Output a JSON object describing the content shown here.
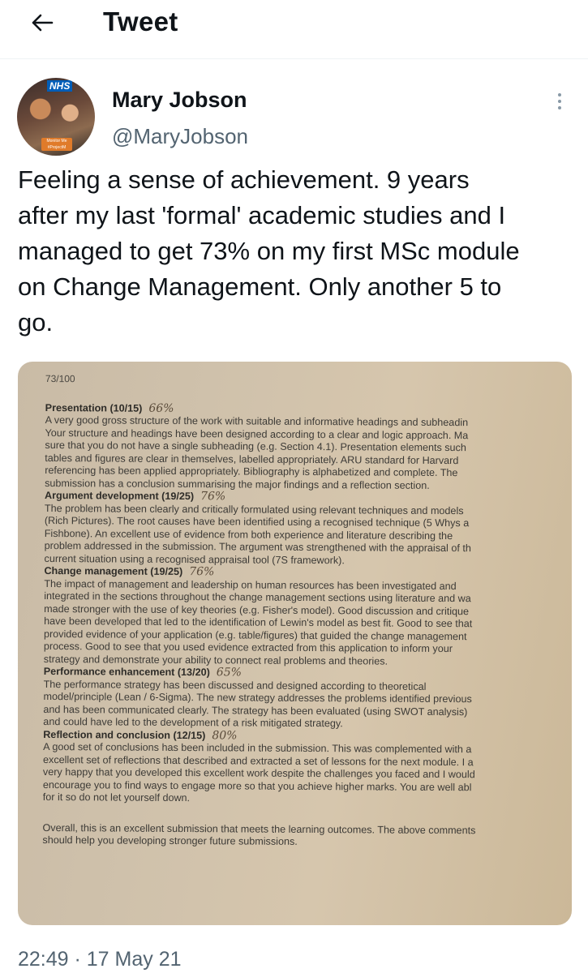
{
  "header": {
    "title": "Tweet",
    "back_icon": "arrow-left-icon"
  },
  "author": {
    "name": "Mary Jobson",
    "handle": "@MaryJobson",
    "avatar_badge": "NHS",
    "avatar_band": "Monitor Me #ProjectM"
  },
  "tweet": {
    "text": "Feeling a sense of achievement.  9 years\nafter my last 'formal' academic studies and I\nmanaged to get 73% on my first MSc module\non Change Management.  Only another 5 to\ngo."
  },
  "image": {
    "score": "73/100",
    "sections": [
      {
        "heading": "Presentation (10/15)",
        "handwritten": "66%",
        "lines": [
          "A very good gross structure of the work with suitable and informative headings and subheadin",
          "Your structure and headings have been designed according to a clear and logic approach. Ma",
          "sure that you do not have a single subheading (e.g. Section 4.1). Presentation elements such",
          "tables and figures are clear in themselves, labelled appropriately. ARU standard for Harvard",
          "referencing has been applied appropriately. Bibliography is alphabetized and complete. The",
          "submission has a conclusion summarising the major findings and a reflection section."
        ]
      },
      {
        "heading": "Argument development (19/25)",
        "handwritten": "76%",
        "lines": [
          "The problem has been clearly and critically formulated using relevant techniques and models",
          "(Rich Pictures). The root causes have been identified using a recognised technique (5 Whys a",
          "Fishbone). An excellent use of evidence from both experience and literature describing the",
          "problem addressed in the submission. The argument was strengthened with the appraisal of th",
          "current situation using a recognised appraisal tool (7S framework)."
        ]
      },
      {
        "heading": "Change management (19/25)",
        "handwritten": "76%",
        "lines": [
          "The impact of management and leadership on human resources has been investigated and",
          "integrated in the sections throughout the change management sections using literature and wa",
          "made stronger with the use of key theories (e.g. Fisher's model). Good discussion and critique",
          "have been developed that led to the identification of Lewin's model as best fit. Good to see that",
          "provided evidence of your application (e.g. table/figures) that guided the change management",
          "process. Good to see that you used evidence extracted from this application to inform your",
          "strategy and demonstrate your ability to connect real problems and theories."
        ]
      },
      {
        "heading": "Performance enhancement (13/20)",
        "handwritten": "65%",
        "lines": [
          "The performance strategy has been discussed and designed according to theoretical",
          "model/principle (Lean / 6-Sigma). The new strategy addresses the problems identified previous",
          "and has been communicated clearly. The strategy has been evaluated (using SWOT analysis)",
          "and could have led to the development of a risk mitigated strategy."
        ]
      },
      {
        "heading": "Reflection and conclusion (12/15)",
        "handwritten": "80%",
        "lines": [
          "A good set of conclusions has been included in the submission. This was complemented with a",
          "excellent set of reflections that described and extracted a set of lessons for the next module. I a",
          "very happy that you developed this excellent work despite the challenges you faced and I would",
          "encourage you to find ways to engage more so that you achieve higher marks. You are well abl",
          "for it so do not let yourself down."
        ]
      }
    ],
    "overall": [
      "Overall, this is an excellent submission that meets the learning outcomes. The above comments",
      "should help you developing stronger future submissions."
    ]
  },
  "meta": {
    "timestamp": "22:49 · 17 May 21"
  }
}
